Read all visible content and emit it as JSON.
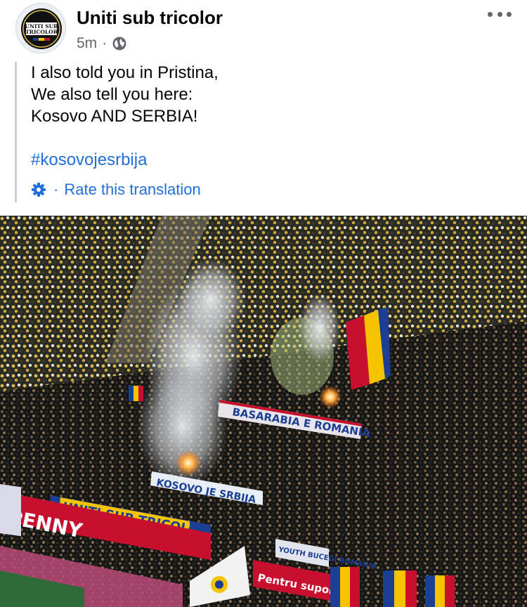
{
  "post": {
    "page_name": "Uniti sub tricolor",
    "time": "5m",
    "separator": "·",
    "privacy_icon": "globe-icon",
    "more_icon": "more-horizontal-icon",
    "avatar": {
      "logo_text_1": "UNITI SUB",
      "logo_text_2": "TRICOLOR"
    }
  },
  "translation": {
    "lines": [
      "I also told you in Pristina,",
      "We also tell you here:",
      "Kosovo AND SERBIA!"
    ],
    "hashtag": "#kosovojesrbija",
    "rate_icon": "gear-icon",
    "rate_separator": "·",
    "rate_label": "Rate this translation"
  },
  "photo": {
    "banner_1": "BASARABIA E ROMANIA",
    "banner_2": "KOSOVO JE SRBIJA",
    "banner_3": "UNITI SUB TRICOLOR",
    "ad_1": "PENNY",
    "ad_2": "Pentru suporteri",
    "ad_3": "YOUTH BUCEGI ROMANIA",
    "colors": {
      "blue": "#1c3f94",
      "yellow": "#f5c400",
      "red": "#c8102e"
    }
  }
}
